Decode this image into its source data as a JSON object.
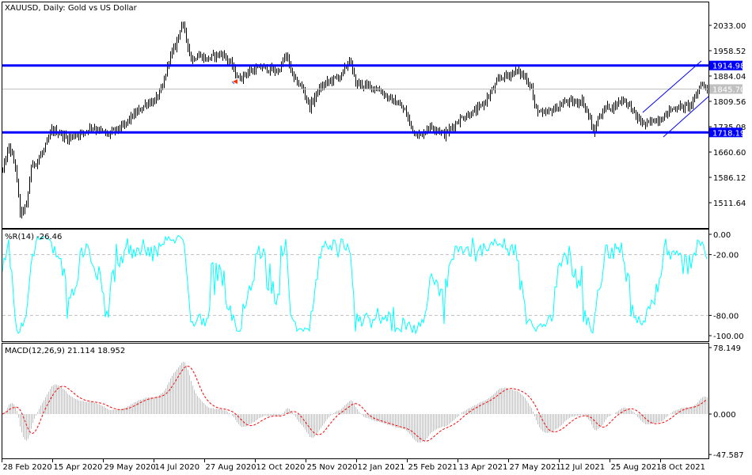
{
  "header": {
    "title": "XAUUSD, Daily:  Gold vs US Dollar"
  },
  "colors": {
    "bars": "#000000",
    "levels": "#0000ff",
    "price_line": "#c0c0c0",
    "wpr": "#00ffff",
    "macd_hist": "#c0c0c0",
    "macd_signal": "#ff0000",
    "channel": "#0000ff"
  },
  "chart_data": [
    {
      "type": "ohlc",
      "title": "XAUUSD, Daily:  Gold vs US Dollar",
      "bar_count": 446,
      "key_closes": [
        [
          0,
          1607
        ],
        [
          4,
          1677
        ],
        [
          8,
          1619
        ],
        [
          11,
          1479
        ],
        [
          15,
          1502
        ],
        [
          18,
          1619
        ],
        [
          21,
          1630
        ],
        [
          26,
          1665
        ],
        [
          31,
          1724
        ],
        [
          36,
          1717
        ],
        [
          41,
          1700
        ],
        [
          46,
          1712
        ],
        [
          51,
          1717
        ],
        [
          56,
          1735
        ],
        [
          61,
          1724
        ],
        [
          66,
          1712
        ],
        [
          71,
          1724
        ],
        [
          76,
          1735
        ],
        [
          81,
          1763
        ],
        [
          86,
          1782
        ],
        [
          91,
          1805
        ],
        [
          96,
          1810
        ],
        [
          101,
          1851
        ],
        [
          105,
          1933
        ],
        [
          109,
          1972
        ],
        [
          113,
          2038
        ],
        [
          115,
          2014
        ],
        [
          119,
          1933
        ],
        [
          124,
          1945
        ],
        [
          129,
          1933
        ],
        [
          134,
          1945
        ],
        [
          139,
          1949
        ],
        [
          144,
          1921
        ],
        [
          149,
          1875
        ],
        [
          154,
          1893
        ],
        [
          159,
          1903
        ],
        [
          164,
          1910
        ],
        [
          169,
          1903
        ],
        [
          174,
          1898
        ],
        [
          179,
          1945
        ],
        [
          184,
          1875
        ],
        [
          189,
          1851
        ],
        [
          194,
          1793
        ],
        [
          199,
          1840
        ],
        [
          204,
          1863
        ],
        [
          209,
          1875
        ],
        [
          214,
          1886
        ],
        [
          219,
          1933
        ],
        [
          223,
          1863
        ],
        [
          229,
          1856
        ],
        [
          234,
          1851
        ],
        [
          239,
          1840
        ],
        [
          244,
          1817
        ],
        [
          249,
          1805
        ],
        [
          254,
          1782
        ],
        [
          259,
          1724
        ],
        [
          264,
          1707
        ],
        [
          269,
          1735
        ],
        [
          274,
          1730
        ],
        [
          279,
          1712
        ],
        [
          284,
          1735
        ],
        [
          289,
          1758
        ],
        [
          294,
          1770
        ],
        [
          299,
          1782
        ],
        [
          304,
          1805
        ],
        [
          309,
          1840
        ],
        [
          314,
          1879
        ],
        [
          319,
          1886
        ],
        [
          324,
          1898
        ],
        [
          329,
          1886
        ],
        [
          334,
          1851
        ],
        [
          336,
          1793
        ],
        [
          341,
          1770
        ],
        [
          346,
          1782
        ],
        [
          351,
          1793
        ],
        [
          356,
          1810
        ],
        [
          361,
          1805
        ],
        [
          366,
          1812
        ],
        [
          371,
          1758
        ],
        [
          373,
          1712
        ],
        [
          376,
          1758
        ],
        [
          381,
          1793
        ],
        [
          386,
          1793
        ],
        [
          391,
          1817
        ],
        [
          396,
          1798
        ],
        [
          401,
          1758
        ],
        [
          406,
          1740
        ],
        [
          411,
          1754
        ],
        [
          416,
          1758
        ],
        [
          421,
          1782
        ],
        [
          426,
          1793
        ],
        [
          431,
          1793
        ],
        [
          436,
          1805
        ],
        [
          439,
          1840
        ],
        [
          441,
          1863
        ],
        [
          445,
          1846
        ]
      ],
      "ylim": [
        1447,
        2099
      ],
      "y_ticks": [
        {
          "value": 2033.0,
          "label": "2033.00"
        },
        {
          "value": 1958.52,
          "label": "1958.52"
        },
        {
          "value": 1884.04,
          "label": "1884.04"
        },
        {
          "value": 1809.56,
          "label": "1809.56"
        },
        {
          "value": 1735.08,
          "label": "1735.08"
        },
        {
          "value": 1660.6,
          "label": "1660.60"
        },
        {
          "value": 1586.12,
          "label": "1586.12"
        },
        {
          "value": 1511.64,
          "label": "1511.64"
        }
      ],
      "levels": [
        {
          "value": 1914.98,
          "label": "1914.98"
        },
        {
          "value": 1718.19,
          "label": "1718.19"
        }
      ],
      "current_price": {
        "value": 1845.7,
        "label": "1845.70"
      },
      "x_ticks": [
        {
          "bar": 0,
          "label": "28 Feb 2020"
        },
        {
          "bar": 32,
          "label": "15 Apr 2020"
        },
        {
          "bar": 64,
          "label": "29 May 2020"
        },
        {
          "bar": 96,
          "label": "14 Jul 2020"
        },
        {
          "bar": 128,
          "label": "27 Aug 2020"
        },
        {
          "bar": 160,
          "label": "12 Oct 2020"
        },
        {
          "bar": 192,
          "label": "25 Nov 2020"
        },
        {
          "bar": 224,
          "label": "12 Jan 2021"
        },
        {
          "bar": 256,
          "label": "25 Feb 2021"
        },
        {
          "bar": 288,
          "label": "13 Apr 2021"
        },
        {
          "bar": 320,
          "label": "27 May 2021"
        },
        {
          "bar": 352,
          "label": "12 Jul 2021"
        },
        {
          "bar": 384,
          "label": "25 Aug 2021"
        },
        {
          "bar": 416,
          "label": "8 Oct 2021"
        }
      ]
    },
    {
      "type": "line",
      "title": "%R(14) -26.46",
      "period": 14,
      "ylim": [
        -100,
        0
      ],
      "levels": [
        -20,
        -80
      ],
      "y_ticks": [
        {
          "value": 0,
          "label": "0.00"
        },
        {
          "value": -20,
          "label": "-20.00"
        },
        {
          "value": -80,
          "label": "-80.00"
        },
        {
          "value": -100,
          "label": "-100.00"
        }
      ]
    },
    {
      "type": "bar",
      "title": "MACD(12,26,9) 21.114 18.952",
      "params": [
        12,
        26,
        9
      ],
      "ylim": [
        -47.587,
        78.149
      ],
      "y_ticks": [
        {
          "value": 78.149,
          "label": "78.149"
        },
        {
          "value": 0,
          "label": "0.000"
        },
        {
          "value": -47.587,
          "label": "-47.587"
        }
      ]
    }
  ]
}
